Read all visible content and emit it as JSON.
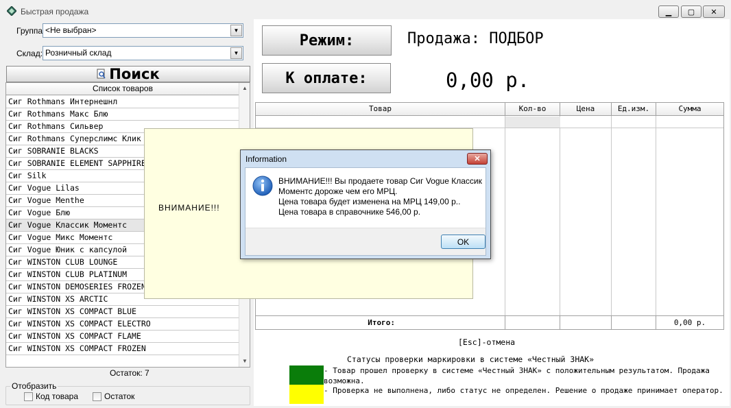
{
  "window": {
    "title": "Быстрая продажа",
    "buttons": {
      "minimize": "▁",
      "maximize": "▢",
      "close": "✕"
    }
  },
  "filters": {
    "group_label": "Группа:",
    "group_value": "<Не выбран>",
    "warehouse_label": "Склад:",
    "warehouse_value": "Розничный склад"
  },
  "search": {
    "label": "Поиск",
    "icon": "search-icon"
  },
  "products": {
    "header": "Список товаров",
    "items": [
      "Сиг Rothmans Интернешнл",
      "Сиг Rothmans Макс Блю",
      "Сиг Rothmans Сильвер",
      "Сиг Rothmans Суперслимс Клик",
      "Сиг SOBRANIE BLACKS",
      "Сиг SOBRANIE ELEMENT SAPPHIRE",
      "Сиг Silk",
      "Сиг Vogue Lilas",
      "Сиг Vogue Menthe",
      "Сиг Vogue Блю",
      "Сиг Vogue Классик Моментс",
      "Сиг Vogue Микс Моментс",
      "Сиг Vogue Юник с капсулой",
      "Сиг WINSTON CLUB LOUNGE",
      "Сиг WINSTON CLUB PLATINUM",
      "Сиг WINSTON DEMOSERIES FROZEN",
      "Сиг WINSTON XS ARCTIC",
      "Сиг WINSTON XS COMPACT BLUE",
      "Сиг WINSTON XS COMPACT ELECTRO",
      "Сиг WINSTON XS COMPACT FLAME",
      "Сиг WINSTON XS COMPACT FROZEN"
    ],
    "selected_index": 10
  },
  "stock": "Остаток: 7",
  "display": {
    "legend": "Отобразить",
    "code_label": "Код товара",
    "stock_label": "Остаток"
  },
  "mode_button": "Режим:",
  "mode_value": "Продажа: ПОДБОР",
  "pay_button": "К оплате:",
  "amount": "0,00 р.",
  "cart": {
    "columns": [
      "Товар",
      "Кол-во",
      "Цена",
      "Ед.изм.",
      "Сумма"
    ],
    "total_label": "Итого:",
    "total_value": "0,00 р."
  },
  "esc_hint": "[Esc]-отмена",
  "marking": {
    "title": "Статусы проверки маркировки в системе «Честный ЗНАК»",
    "ok_color": "#0a7d0a",
    "ok_text": "  -   Товар прошел проверку в системе «Честный ЗНАК» с положительным результатом. Продажа возможна.",
    "warn_color": "#ffff00",
    "warn_text": "  -   Проверка не выполнена, либо статус не определен. Решение о продаже принимает оператор."
  },
  "warning_panel": {
    "text": "ВНИМАНИЕ!!!"
  },
  "dialog": {
    "title": "Information",
    "icon": "info-icon",
    "message_lines": [
      "ВНИМАНИЕ!!! Вы продаете товар Сиг Vogue Классик",
      "Моментс дороже чем его МРЦ.",
      "Цена товара будет изменена на МРЦ 149,00 р..",
      "Цена товара в справочнике 546,00 р."
    ],
    "ok": "OK",
    "close": "✕"
  }
}
